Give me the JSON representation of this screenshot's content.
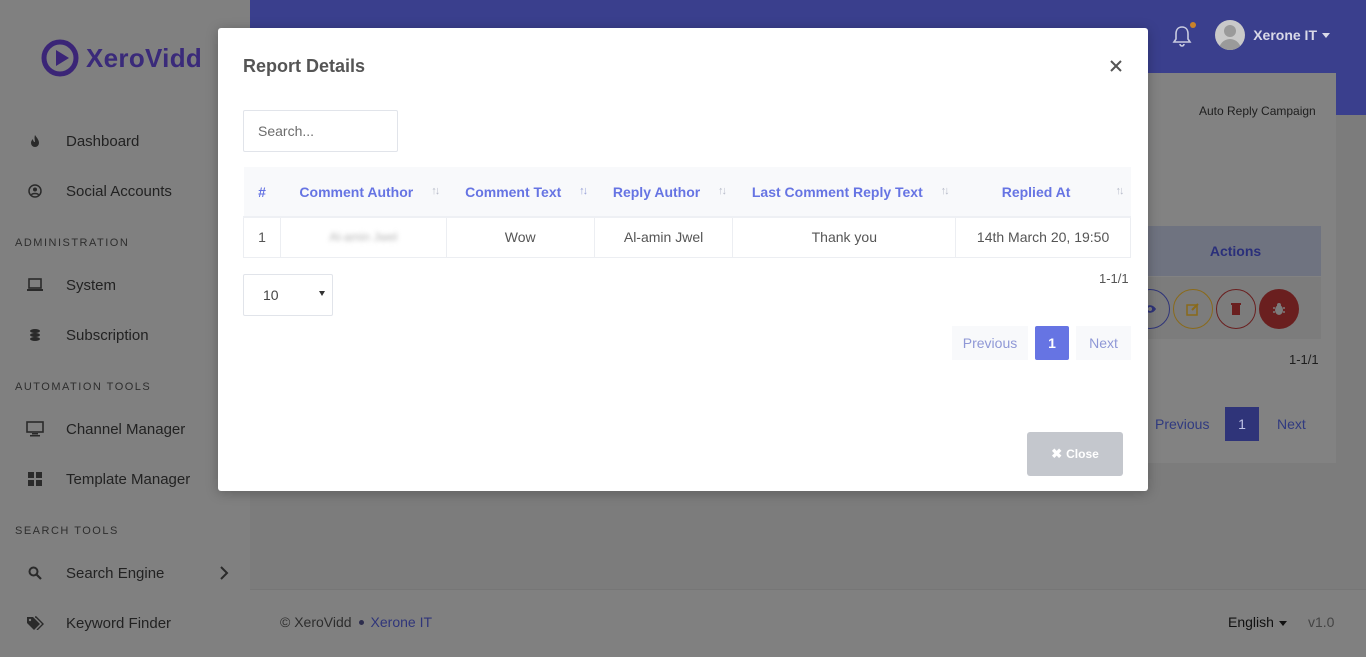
{
  "brand": {
    "name": "XeroVidd",
    "color": "#4b2c91"
  },
  "sidebar": {
    "items_top": [
      {
        "label": "Dashboard",
        "icon": "flame-icon"
      },
      {
        "label": "Social Accounts",
        "icon": "user-circle-icon"
      }
    ],
    "section_admin": "ADMINISTRATION",
    "items_admin": [
      {
        "label": "System",
        "icon": "laptop-icon"
      },
      {
        "label": "Subscription",
        "icon": "coins-icon"
      }
    ],
    "section_automation": "AUTOMATION TOOLS",
    "items_automation": [
      {
        "label": "Channel Manager",
        "icon": "monitor-icon"
      },
      {
        "label": "Template Manager",
        "icon": "grid-icon"
      }
    ],
    "section_search": "SEARCH TOOLS",
    "items_search": [
      {
        "label": "Search Engine",
        "icon": "search-icon"
      },
      {
        "label": "Keyword Finder",
        "icon": "tags-icon"
      }
    ]
  },
  "header": {
    "user_name": "Xerone IT",
    "notification_icon": "bell-icon"
  },
  "background": {
    "breadcrumb": "Auto Reply Campaign",
    "actions_header": "Actions",
    "count": "1-1/1",
    "previous": "Previous",
    "page": "1",
    "next": "Next"
  },
  "footer": {
    "copyright": "© XeroVidd",
    "company": "Xerone IT",
    "language": "English",
    "version": "v1.0"
  },
  "modal": {
    "title": "Report Details",
    "search_placeholder": "Search...",
    "columns": [
      "#",
      "Comment Author",
      "Comment Text",
      "Reply Author",
      "Last Comment Reply Text",
      "Replied At"
    ],
    "rows": [
      {
        "num": "1",
        "comment_author": "Al-amin Jwel",
        "comment_text": "Wow",
        "reply_author": "Al-amin Jwel",
        "reply_text": "Thank you",
        "replied_at": "14th March 20, 19:50"
      }
    ],
    "page_length": "10",
    "count": "1-1/1",
    "previous": "Previous",
    "current_page": "1",
    "next": "Next",
    "close_label": "Close",
    "accent": "#6674e3"
  }
}
